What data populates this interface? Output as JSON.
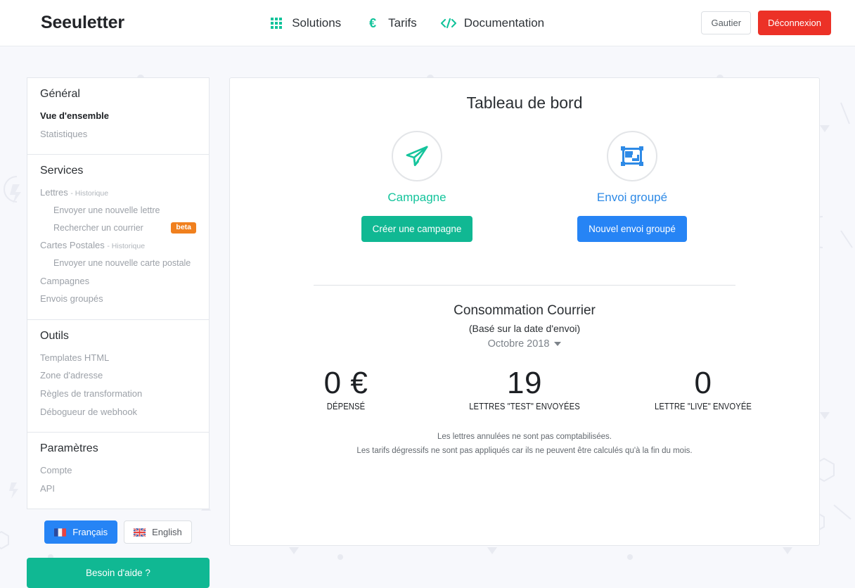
{
  "brand": "Seeuletter",
  "nav": {
    "items": [
      {
        "label": "Solutions",
        "icon": "grid-icon"
      },
      {
        "label": "Tarifs",
        "icon": "euro-icon"
      },
      {
        "label": "Documentation",
        "icon": "code-icon"
      }
    ],
    "user_label": "Gautier",
    "logout_label": "Déconnexion"
  },
  "sidebar": {
    "groups": [
      {
        "title": "Général",
        "items": [
          {
            "label": "Vue d'ensemble",
            "state": "active"
          },
          {
            "label": "Statistiques",
            "state": "normal"
          }
        ]
      },
      {
        "title": "Services",
        "items": [
          {
            "label": "Lettres",
            "suffix": "- Historique",
            "state": "normal"
          },
          {
            "label": "Envoyer une nouvelle lettre",
            "state": "sub"
          },
          {
            "label": "Rechercher un courrier",
            "state": "sub",
            "badge": "beta"
          },
          {
            "label": "Cartes Postales",
            "suffix": "- Historique",
            "state": "normal"
          },
          {
            "label": "Envoyer une nouvelle carte postale",
            "state": "sub"
          },
          {
            "label": "Campagnes",
            "state": "normal"
          },
          {
            "label": "Envois groupés",
            "state": "normal"
          }
        ]
      },
      {
        "title": "Outils",
        "items": [
          {
            "label": "Templates HTML",
            "state": "normal"
          },
          {
            "label": "Zone d'adresse",
            "state": "normal"
          },
          {
            "label": "Règles de transformation",
            "state": "normal"
          },
          {
            "label": "Débogueur de webhook",
            "state": "normal"
          }
        ]
      },
      {
        "title": "Paramètres",
        "items": [
          {
            "label": "Compte",
            "state": "normal"
          },
          {
            "label": "API",
            "state": "normal"
          }
        ]
      }
    ],
    "languages": [
      {
        "label": "Français",
        "flag": "fr-flag-icon",
        "selected": true
      },
      {
        "label": "English",
        "flag": "gb-flag-icon",
        "selected": false
      }
    ],
    "help_label": "Besoin d'aide ?"
  },
  "main": {
    "title": "Tableau de bord",
    "ctas": [
      {
        "label": "Campagne",
        "icon": "paper-plane-icon",
        "button": "Créer une campagne",
        "color": "#10b893"
      },
      {
        "label": "Envoi groupé",
        "icon": "object-group-icon",
        "button": "Nouvel envoi groupé",
        "color": "#2684f5"
      }
    ],
    "consumption": {
      "title": "Consommation Courrier",
      "subtitle": "(Basé sur la date d'envoi)",
      "month": "Octobre 2018",
      "stats": [
        {
          "value": "0 €",
          "label": "DÉPENSÉ"
        },
        {
          "value": "19",
          "label": "LETTRES \"TEST\" ENVOYÉES"
        },
        {
          "value": "0",
          "label": "LETTRE \"LIVE\" ENVOYÉE"
        }
      ],
      "notes": [
        "Les lettres annulées ne sont pas comptabilisées.",
        "Les tarifs dégressifs ne sont pas appliqués car ils ne peuvent être calculés qu'à la fin du mois."
      ]
    }
  },
  "colors": {
    "accent_green": "#10b893",
    "accent_blue": "#2684f5",
    "danger_red": "#ec3127",
    "badge_orange": "#f0801e",
    "page_bg": "#f7f8fc"
  }
}
